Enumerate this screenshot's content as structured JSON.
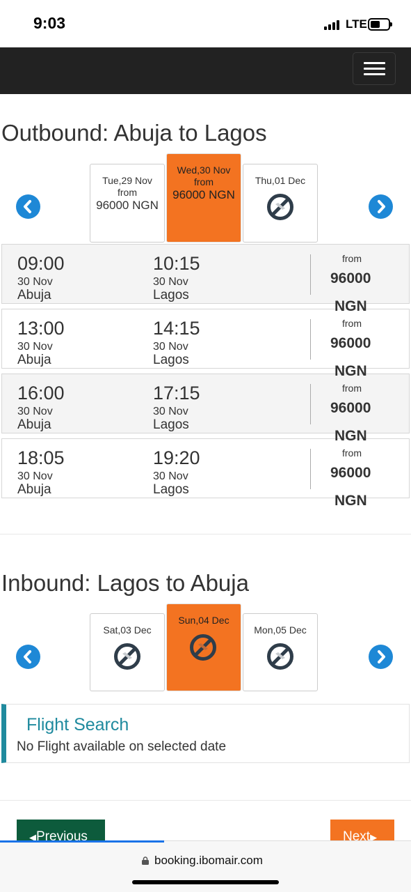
{
  "status_bar": {
    "time": "9:03",
    "network": "LTE"
  },
  "outbound": {
    "title": "Outbound: Abuja to Lagos",
    "dates": [
      {
        "label": "Tue,29 Nov",
        "from": "from",
        "price": "96000 NGN",
        "available": true,
        "selected": false
      },
      {
        "label": "Wed,30 Nov",
        "from": "from",
        "price": "96000 NGN",
        "available": true,
        "selected": true
      },
      {
        "label": "Thu,01 Dec",
        "available": false,
        "selected": false
      }
    ],
    "flights": [
      {
        "dep_time": "09:00",
        "dep_date": "30 Nov",
        "dep_city": "Abuja",
        "arr_time": "10:15",
        "arr_date": "30 Nov",
        "arr_city": "Lagos",
        "from": "from",
        "price": "96000",
        "currency": "NGN"
      },
      {
        "dep_time": "13:00",
        "dep_date": "30 Nov",
        "dep_city": "Abuja",
        "arr_time": "14:15",
        "arr_date": "30 Nov",
        "arr_city": "Lagos",
        "from": "from",
        "price": "96000",
        "currency": "NGN"
      },
      {
        "dep_time": "16:00",
        "dep_date": "30 Nov",
        "dep_city": "Abuja",
        "arr_time": "17:15",
        "arr_date": "30 Nov",
        "arr_city": "Lagos",
        "from": "from",
        "price": "96000",
        "currency": "NGN"
      },
      {
        "dep_time": "18:05",
        "dep_date": "30 Nov",
        "dep_city": "Abuja",
        "arr_time": "19:20",
        "arr_date": "30 Nov",
        "arr_city": "Lagos",
        "from": "from",
        "price": "96000",
        "currency": "NGN"
      }
    ]
  },
  "inbound": {
    "title": "Inbound: Lagos to Abuja",
    "dates": [
      {
        "label": "Sat,03 Dec",
        "available": false,
        "selected": false
      },
      {
        "label": "Sun,04 Dec",
        "available": false,
        "selected": true
      },
      {
        "label": "Mon,05 Dec",
        "available": false,
        "selected": false
      }
    ]
  },
  "flight_search": {
    "title": "Flight Search",
    "message": "No Flight available on selected date"
  },
  "buttons": {
    "previous": "Previous",
    "next": "Next"
  },
  "browser": {
    "url": "booking.ibomair.com"
  },
  "colors": {
    "accent_orange": "#f37321",
    "nav_dark": "#222222",
    "arrow_blue": "#1e88d6",
    "teal": "#1f8a9e",
    "prev_green": "#0d5b3c"
  },
  "icons": [
    "chevron-left-icon",
    "chevron-right-icon",
    "no-flight-icon",
    "menu-icon",
    "lock-icon",
    "caret-left-icon",
    "caret-right-icon"
  ]
}
